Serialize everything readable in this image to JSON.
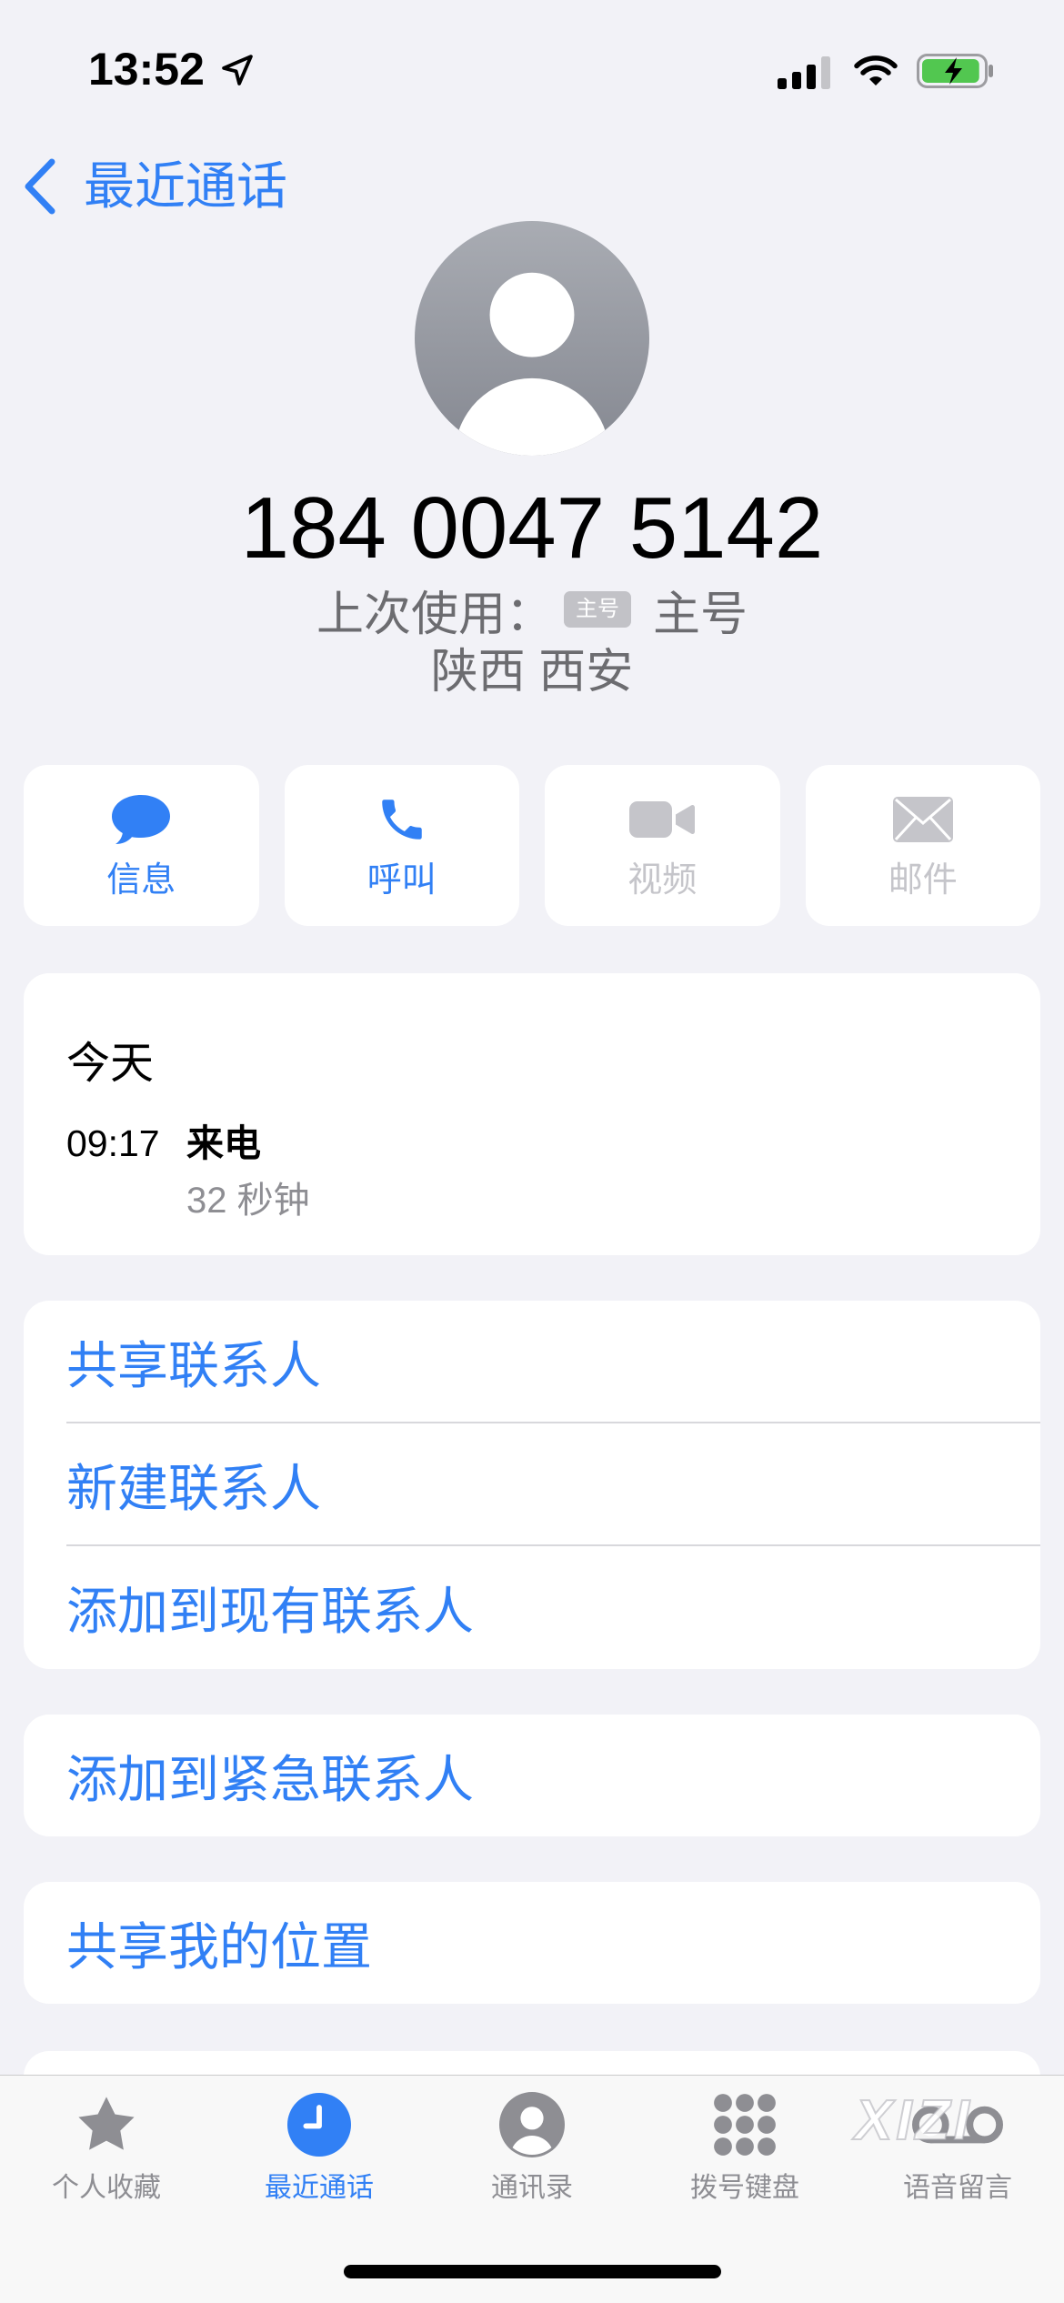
{
  "status_bar": {
    "time": "13:52",
    "signal_bars": 3,
    "signal_max": 4,
    "battery_level": 0.95,
    "charging": true
  },
  "nav": {
    "back_label": "最近通话"
  },
  "contact": {
    "avatar_icon": "person-silhouette-icon",
    "number": "184 0047 5142",
    "last_used_label": "上次使用：",
    "line_badge": "主号",
    "line_name": "主号",
    "location": "陕西 西安"
  },
  "actions": [
    {
      "label": "信息",
      "icon": "message-icon",
      "enabled": true
    },
    {
      "label": "呼叫",
      "icon": "phone-icon",
      "enabled": true
    },
    {
      "label": "视频",
      "icon": "video-icon",
      "enabled": false
    },
    {
      "label": "邮件",
      "icon": "mail-icon",
      "enabled": false
    }
  ],
  "history": {
    "day": "今天",
    "entries": [
      {
        "time": "09:17",
        "type": "来电",
        "duration": "32 秒钟"
      }
    ]
  },
  "contact_options": [
    {
      "label": "共享联系人"
    },
    {
      "label": "新建联系人"
    },
    {
      "label": "添加到现有联系人"
    }
  ],
  "emergency_option": {
    "label": "添加到紧急联系人"
  },
  "location_option": {
    "label": "共享我的位置"
  },
  "tab_bar": {
    "items": [
      {
        "label": "个人收藏",
        "icon": "star-icon",
        "selected": false
      },
      {
        "label": "最近通话",
        "icon": "clock-icon",
        "selected": true
      },
      {
        "label": "通讯录",
        "icon": "person-circle-icon",
        "selected": false
      },
      {
        "label": "拨号键盘",
        "icon": "keypad-icon",
        "selected": false
      },
      {
        "label": "语音留言",
        "icon": "voicemail-icon",
        "selected": false
      }
    ]
  },
  "watermark": "XIZI",
  "colors": {
    "accent": "#3180f5",
    "background": "#f2f2f7",
    "card": "#ffffff",
    "secondary_text": "#8e8e93",
    "subtitle_text": "#6c6c70",
    "disabled": "#c5c5ca",
    "separator": "#d8d8dc",
    "badge": "#c2c2c7",
    "battery": "#52c750",
    "tab_inactive": "#8e8e93"
  }
}
